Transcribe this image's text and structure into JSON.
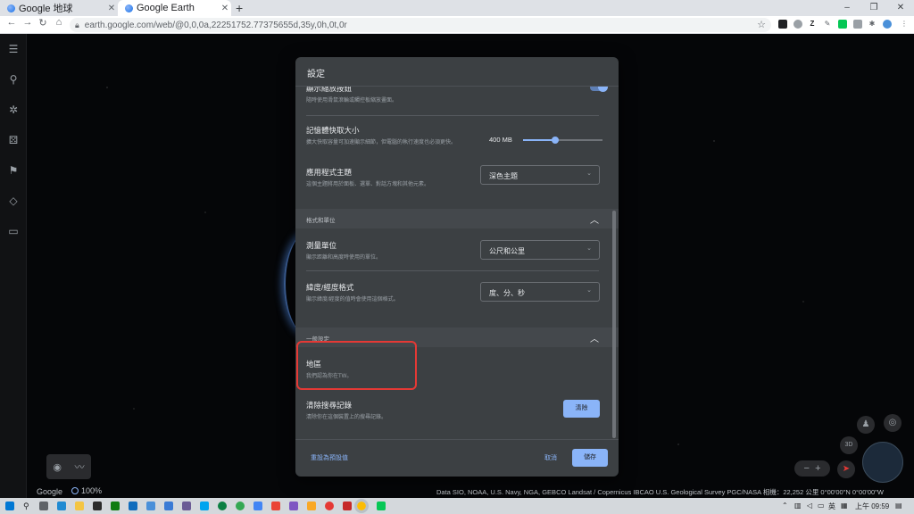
{
  "browser": {
    "tabs": [
      {
        "label": "Google 地球",
        "active": false
      },
      {
        "label": "Google Earth",
        "active": true
      }
    ],
    "new_tab": "+",
    "url": "earth.google.com/web/@0,0,0a,22251752.77375655d,35y,0h,0t,0r",
    "window_controls": [
      "–",
      "❐",
      "✕"
    ]
  },
  "dialog": {
    "title": "設定",
    "partial_row": {
      "title": "顯示縮放按鈕",
      "desc": "隨時使用滑鼠滾輪或觸控板縮放畫面。",
      "toggle_on": true
    },
    "cache": {
      "title": "記憶體快取大小",
      "desc": "擴大快取容量可加速顯示細節，但電腦的執行速度也必須更快。",
      "value": "400 MB",
      "level_fraction": 0.4
    },
    "theme": {
      "title": "應用程式主題",
      "desc": "這個主題將用於面板、選單、對話方塊和其他元素。",
      "selected": "深色主題"
    },
    "section_units": {
      "label": "格式和單位"
    },
    "measurement": {
      "title": "測量單位",
      "desc": "顯示距離和高度時使用的單位。",
      "selected": "公尺和公里"
    },
    "latlng": {
      "title": "緯度/經度格式",
      "desc": "顯示緯度/經度的值時會使用這個格式。",
      "selected": "度、分、秒"
    },
    "section_general": {
      "label": "一般設定"
    },
    "region": {
      "title": "地區",
      "desc": "我們認為你在TW。"
    },
    "clear_history": {
      "title": "清除搜尋記錄",
      "desc": "清除你在這個裝置上的搜尋記錄。",
      "button": "清除"
    },
    "footer": {
      "reset": "重設為預設值",
      "cancel": "取消",
      "save": "儲存"
    }
  },
  "map": {
    "logo": "Google",
    "loading_pct": "100%",
    "attribution": "Data SIO, NOAA, U.S. Navy, NGA, GEBCO  Landsat / Copernicus  IBCAO  U.S. Geological Survey  PGC/NASA     相機：22,252 公里   0°00'00\"N 0°00'00\"W",
    "view_3d": "3D",
    "zoom_out": "−",
    "zoom_in": "+"
  },
  "taskbar": {
    "tray_ime": "英",
    "tray_time": "上午 09:59"
  },
  "colors": {
    "accent": "#8ab4f8",
    "dialog_bg": "#3c4043",
    "highlight": "#e53935"
  }
}
